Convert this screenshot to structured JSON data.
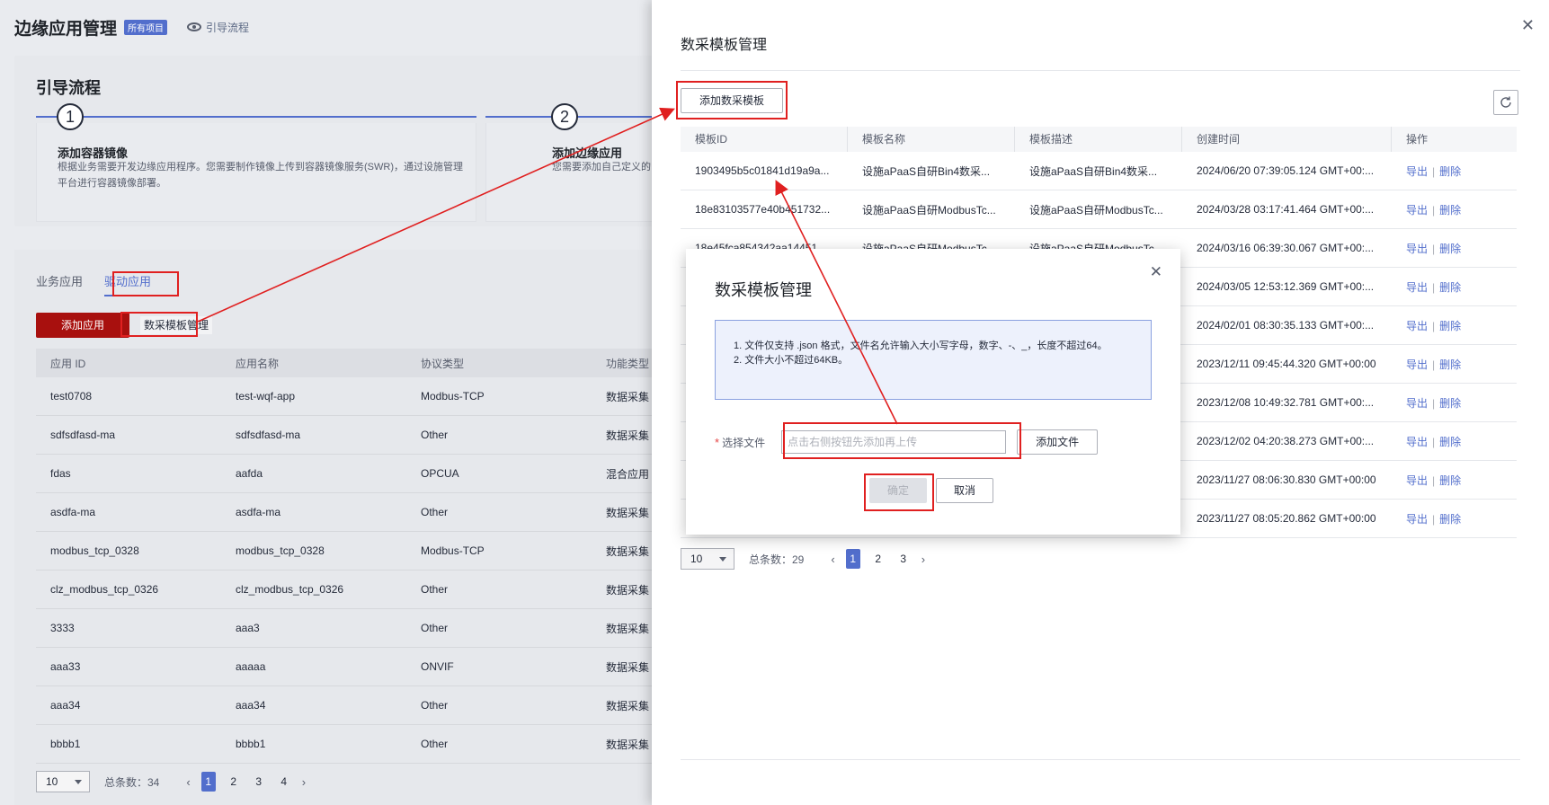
{
  "background": {
    "title": "边缘应用管理",
    "badge": "所有项目",
    "guide_link": "引导流程",
    "guide": {
      "heading": "引导流程",
      "steps": [
        {
          "num": "1",
          "title": "添加容器镜像",
          "desc": "根据业务需要开发边缘应用程序。您需要制作镜像上传到容器镜像服务(SWR)，通过设施管理平台进行容器镜像部署。"
        },
        {
          "num": "2",
          "title": "添加边缘应用",
          "desc": "您需要添加自己定义的"
        }
      ]
    },
    "tabs": [
      "业务应用",
      "驱动应用"
    ],
    "add_app_button": "添加应用",
    "template_mgmt_button": "数采模板管理",
    "table": {
      "headers": [
        "应用 ID",
        "应用名称",
        "协议类型",
        "功能类型"
      ],
      "rows": [
        [
          "test0708",
          "test-wqf-app",
          "Modbus-TCP",
          "数据采集"
        ],
        [
          "sdfsdfasd-ma",
          "sdfsdfasd-ma",
          "Other",
          "数据采集"
        ],
        [
          "fdas",
          "aafda",
          "OPCUA",
          "混合应用"
        ],
        [
          "asdfa-ma",
          "asdfa-ma",
          "Other",
          "数据采集"
        ],
        [
          "modbus_tcp_0328",
          "modbus_tcp_0328",
          "Modbus-TCP",
          "数据采集"
        ],
        [
          "clz_modbus_tcp_0326",
          "clz_modbus_tcp_0326",
          "Other",
          "数据采集"
        ],
        [
          "3333",
          "aaa3",
          "Other",
          "数据采集"
        ],
        [
          "aaa33",
          "aaaaa",
          "ONVIF",
          "数据采集"
        ],
        [
          "aaa34",
          "aaa34",
          "Other",
          "数据采集"
        ],
        [
          "bbbb1",
          "bbbb1",
          "Other",
          "数据采集"
        ]
      ]
    },
    "pager": {
      "page_size": "10",
      "total": "总条数：34",
      "pages": [
        "1",
        "2",
        "3",
        "4"
      ],
      "current": "1"
    }
  },
  "drawer": {
    "title": "数采模板管理",
    "add_button": "添加数采模板",
    "table": {
      "headers": [
        "模板ID",
        "模板名称",
        "模板描述",
        "创建时间",
        "操作"
      ],
      "rows": [
        [
          "1903495b5c01841d19a9a...",
          "设施aPaaS自研Bin4数采...",
          "设施aPaaS自研Bin4数采...",
          "2024/06/20 07:39:05.124 GMT+00:..."
        ],
        [
          "18e83103577e40b451732...",
          "设施aPaaS自研ModbusTc...",
          "设施aPaaS自研ModbusTc...",
          "2024/03/28 03:17:41.464 GMT+00:..."
        ],
        [
          "18e45fca854342aa14451...",
          "设施aPaaS自研ModbusTc...",
          "设施aPaaS自研ModbusTc...",
          "2024/03/16 06:39:30.067 GMT+00:..."
        ],
        [
          "",
          "",
          "",
          "2024/03/05 12:53:12.369 GMT+00:..."
        ],
        [
          "",
          "",
          "",
          "2024/02/01 08:30:35.133 GMT+00:..."
        ],
        [
          "",
          "",
          "",
          "2023/12/11 09:45:44.320 GMT+00:00"
        ],
        [
          "",
          "",
          "",
          "2023/12/08 10:49:32.781 GMT+00:..."
        ],
        [
          "",
          "",
          "",
          "2023/12/02 04:20:38.273 GMT+00:..."
        ],
        [
          "",
          "",
          "",
          "2023/11/27 08:06:30.830 GMT+00:00"
        ],
        [
          "",
          "",
          "",
          "2023/11/27 08:05:20.862 GMT+00:00"
        ]
      ],
      "export_label": "导出",
      "delete_label": "删除"
    },
    "pager": {
      "page_size": "10",
      "total": "总条数：29",
      "pages": [
        "1",
        "2",
        "3"
      ],
      "current": "1"
    }
  },
  "modal": {
    "title": "数采模板管理",
    "notes": [
      "1. 文件仅支持 .json 格式，文件名允许输入大小写字母，数字、-、_，长度不超过64。",
      "2. 文件大小不超过64KB。"
    ],
    "file_label": "选择文件",
    "file_placeholder": "点击右侧按钮先添加再上传",
    "add_file_button": "添加文件",
    "ok_button": "确定",
    "cancel_button": "取消"
  },
  "icons": {
    "close": "close-icon",
    "refresh": "refresh-icon",
    "view": "eye-icon"
  },
  "colors": {
    "accent": "#526ecc",
    "brand_red": "#a8100e",
    "annotation_red": "#e02020"
  }
}
